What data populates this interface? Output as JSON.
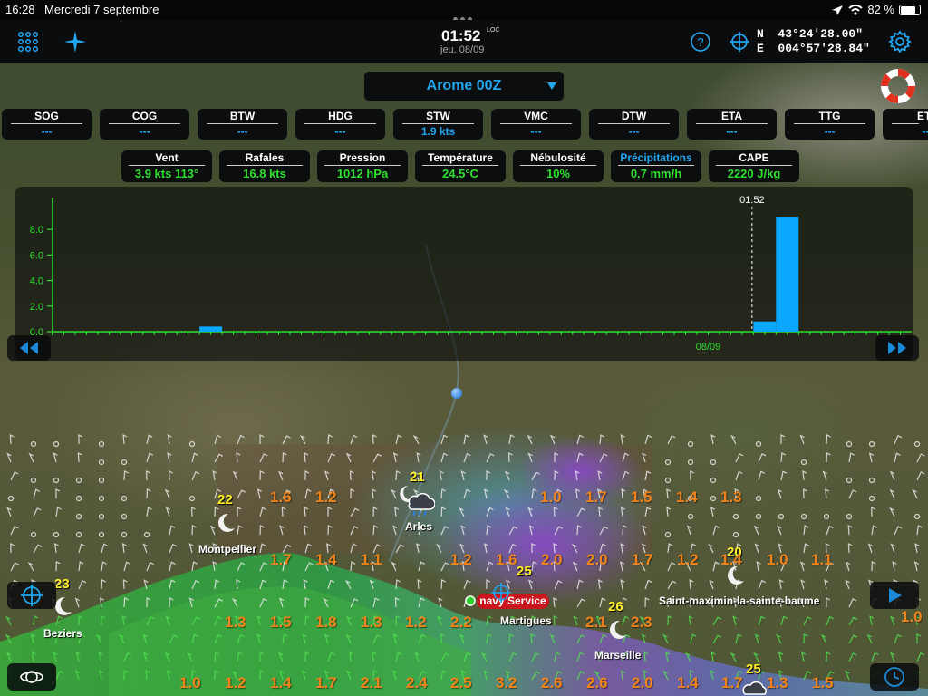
{
  "status_bar": {
    "time": "16:28",
    "date": "Mercredi 7 septembre",
    "battery": "82 %"
  },
  "toolbar": {
    "clock": "01:52",
    "clock_suffix": "LOC",
    "clock_date": "jeu. 08/09",
    "lat_hemi": "N",
    "lat": "43°24'28.00\"",
    "lon_hemi": "E",
    "lon": "004°57'28.84\"",
    "icons": [
      "grid-menu-icon",
      "compass-star-icon",
      "help-icon",
      "crosshair-icon",
      "settings-gear-icon"
    ]
  },
  "model": {
    "label": "Arome 00Z"
  },
  "nav_cells": [
    {
      "title": "SOG",
      "value": "---"
    },
    {
      "title": "COG",
      "value": "---"
    },
    {
      "title": "BTW",
      "value": "---"
    },
    {
      "title": "HDG",
      "value": "---"
    },
    {
      "title": "STW",
      "value": "1.9 kts"
    },
    {
      "title": "VMC",
      "value": "---"
    },
    {
      "title": "DTW",
      "value": "---"
    },
    {
      "title": "ETA",
      "value": "---"
    },
    {
      "title": "TTG",
      "value": "---"
    },
    {
      "title": "ETA",
      "value": "---"
    }
  ],
  "weather_cells": [
    {
      "title": "Vent",
      "value": "3.9 kts 113°"
    },
    {
      "title": "Rafales",
      "value": "16.8 kts"
    },
    {
      "title": "Pression",
      "value": "1012 hPa"
    },
    {
      "title": "Température",
      "value": "24.5°C"
    },
    {
      "title": "Nébulosité",
      "value": "10%"
    },
    {
      "title": "Précipitations",
      "value": "0.7 mm/h",
      "selected": true
    },
    {
      "title": "CAPE",
      "value": "2220 J/kg"
    }
  ],
  "chart_data": {
    "type": "bar",
    "title": "",
    "ylabel": "",
    "ylim": [
      0,
      9.5
    ],
    "yticks": [
      "0.0",
      "2.0",
      "4.0",
      "6.0",
      "8.0"
    ],
    "xlim": [
      0,
      76
    ],
    "x_tick_label": "08/09",
    "x_tick_pos": 58,
    "now_label": "01:52",
    "now_pos": 63,
    "color": "#0aa8ff",
    "bars": [
      {
        "x": 14,
        "value": 0.4
      },
      {
        "x": 63,
        "value": 0.8
      },
      {
        "x": 65,
        "value": 9.0
      }
    ]
  },
  "map": {
    "cities": [
      {
        "name": "Arles"
      },
      {
        "name": "Montpellier"
      },
      {
        "name": "Beziers"
      },
      {
        "name": "Martigues"
      },
      {
        "name": "Marseille"
      },
      {
        "name": "Saint-maximin-la-sainte-baume"
      }
    ],
    "service_label": "navy Service",
    "temperatures": [
      "21",
      "22",
      "23",
      "25",
      "26",
      "20",
      "25"
    ],
    "gusts_row1": [
      "1.6",
      "1.2",
      "1.0",
      "1.7",
      "1.5",
      "1.4",
      "1.3"
    ],
    "gusts_row2": [
      "1.7",
      "1.4",
      "1.1",
      "1.2",
      "1.6",
      "2.0",
      "2.0",
      "1.7",
      "1.2",
      "1.4",
      "1.0",
      "1.1"
    ],
    "gusts_row3": [
      "1.3",
      "1.5",
      "1.8",
      "1.3",
      "1.2",
      "2.2",
      "2.1",
      "2.3",
      "1.0"
    ],
    "gusts_row4": [
      "1.0",
      "1.2",
      "1.4",
      "1.7",
      "2.1",
      "2.4",
      "2.5",
      "3.2",
      "2.6",
      "2.6",
      "2.0",
      "1.4",
      "1.7",
      "1.3",
      "1.5"
    ]
  },
  "colors": {
    "accent": "#22a6f0",
    "value_green": "#2ee02e",
    "gust_orange": "#f0841a",
    "temp_yellow": "#ffef2a",
    "bar": "#0aa8ff"
  }
}
